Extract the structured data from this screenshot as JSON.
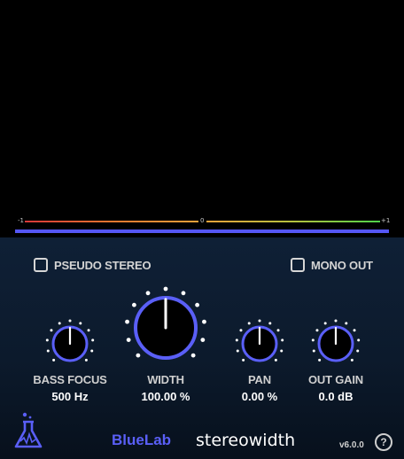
{
  "meter": {
    "scale_min": "-1",
    "scale_mid": "0",
    "scale_max": "+1",
    "colors": {
      "left": "#e23b3b",
      "mid": "#f0a23a",
      "right": "#4fd24a",
      "bar": "#5557f5"
    }
  },
  "options": {
    "pseudo_stereo": {
      "label": "PSEUDO STEREO",
      "checked": false
    },
    "mono_out": {
      "label": "MONO OUT",
      "checked": false
    }
  },
  "knobs": [
    {
      "id": "bass-focus",
      "label": "BASS FOCUS",
      "value": "500 Hz",
      "level": 0.5
    },
    {
      "id": "width",
      "label": "WIDTH",
      "value": "100.00 %",
      "level": 0.5
    },
    {
      "id": "pan",
      "label": "PAN",
      "value": "0.00 %",
      "level": 0.5
    },
    {
      "id": "out-gain",
      "label": "OUT GAIN",
      "value": "0.0 dB",
      "level": 0.5
    }
  ],
  "footer": {
    "brand": "BlueLab",
    "product": "stereowidth",
    "version": "v6.0.0",
    "help": "?"
  },
  "accent_color": "#5a5ff7",
  "icons": [
    "flask-icon",
    "help-icon"
  ]
}
